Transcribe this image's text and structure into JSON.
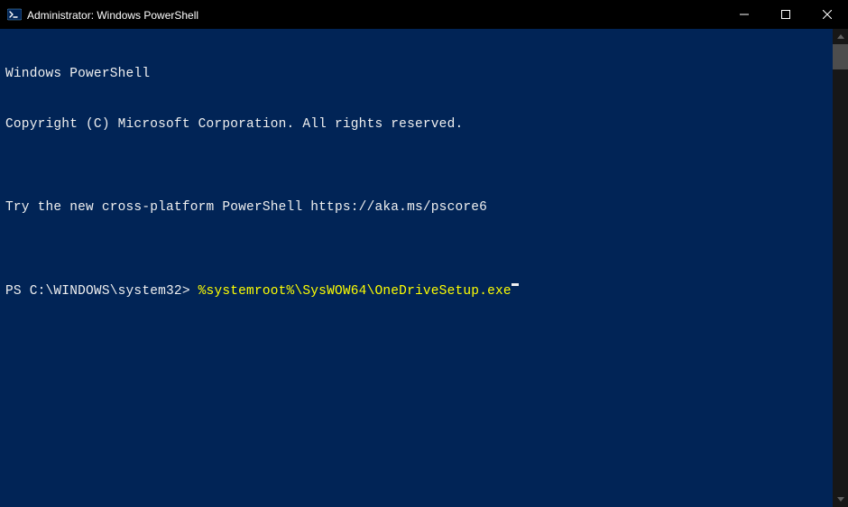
{
  "titlebar": {
    "title": "Administrator: Windows PowerShell"
  },
  "terminal": {
    "line1": "Windows PowerShell",
    "line2": "Copyright (C) Microsoft Corporation. All rights reserved.",
    "line3": "",
    "line4": "Try the new cross-platform PowerShell https://aka.ms/pscore6",
    "line5": "",
    "prompt": "PS C:\\WINDOWS\\system32> ",
    "command": "%systemroot%\\SysWOW64\\OneDriveSetup.exe"
  },
  "icons": {
    "powershell": "powershell-icon",
    "minimize": "minimize-icon",
    "maximize": "maximize-icon",
    "close": "close-icon"
  }
}
